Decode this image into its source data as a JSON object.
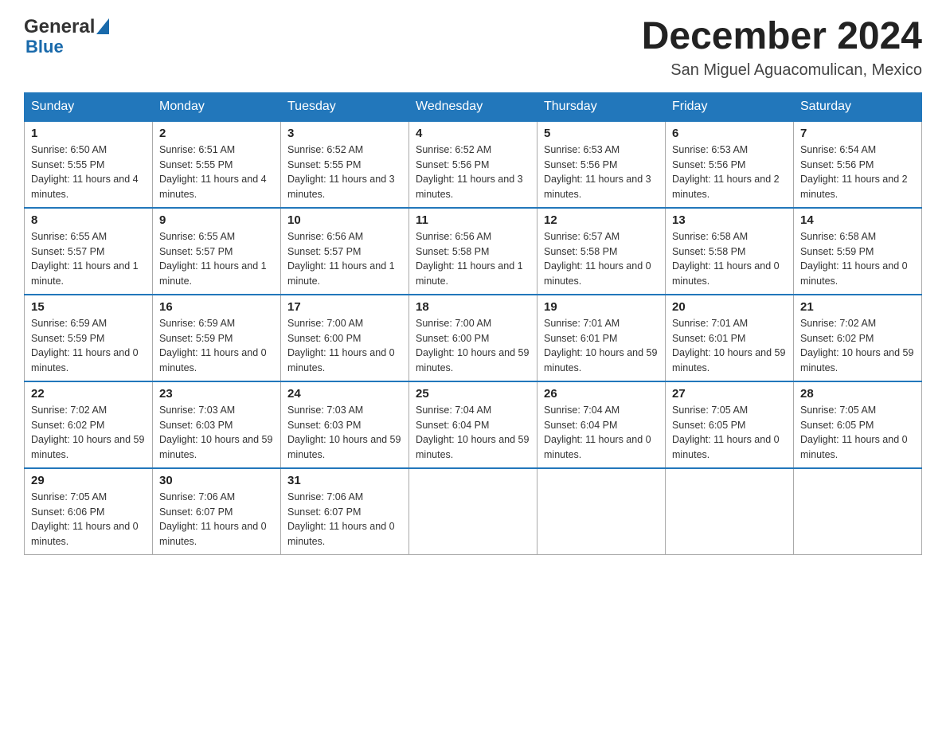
{
  "header": {
    "logo_general": "General",
    "logo_blue": "Blue",
    "month_title": "December 2024",
    "location": "San Miguel Aguacomulican, Mexico"
  },
  "days_of_week": [
    "Sunday",
    "Monday",
    "Tuesday",
    "Wednesday",
    "Thursday",
    "Friday",
    "Saturday"
  ],
  "weeks": [
    [
      {
        "day": "1",
        "sunrise": "6:50 AM",
        "sunset": "5:55 PM",
        "daylight": "11 hours and 4 minutes."
      },
      {
        "day": "2",
        "sunrise": "6:51 AM",
        "sunset": "5:55 PM",
        "daylight": "11 hours and 4 minutes."
      },
      {
        "day": "3",
        "sunrise": "6:52 AM",
        "sunset": "5:55 PM",
        "daylight": "11 hours and 3 minutes."
      },
      {
        "day": "4",
        "sunrise": "6:52 AM",
        "sunset": "5:56 PM",
        "daylight": "11 hours and 3 minutes."
      },
      {
        "day": "5",
        "sunrise": "6:53 AM",
        "sunset": "5:56 PM",
        "daylight": "11 hours and 3 minutes."
      },
      {
        "day": "6",
        "sunrise": "6:53 AM",
        "sunset": "5:56 PM",
        "daylight": "11 hours and 2 minutes."
      },
      {
        "day": "7",
        "sunrise": "6:54 AM",
        "sunset": "5:56 PM",
        "daylight": "11 hours and 2 minutes."
      }
    ],
    [
      {
        "day": "8",
        "sunrise": "6:55 AM",
        "sunset": "5:57 PM",
        "daylight": "11 hours and 1 minute."
      },
      {
        "day": "9",
        "sunrise": "6:55 AM",
        "sunset": "5:57 PM",
        "daylight": "11 hours and 1 minute."
      },
      {
        "day": "10",
        "sunrise": "6:56 AM",
        "sunset": "5:57 PM",
        "daylight": "11 hours and 1 minute."
      },
      {
        "day": "11",
        "sunrise": "6:56 AM",
        "sunset": "5:58 PM",
        "daylight": "11 hours and 1 minute."
      },
      {
        "day": "12",
        "sunrise": "6:57 AM",
        "sunset": "5:58 PM",
        "daylight": "11 hours and 0 minutes."
      },
      {
        "day": "13",
        "sunrise": "6:58 AM",
        "sunset": "5:58 PM",
        "daylight": "11 hours and 0 minutes."
      },
      {
        "day": "14",
        "sunrise": "6:58 AM",
        "sunset": "5:59 PM",
        "daylight": "11 hours and 0 minutes."
      }
    ],
    [
      {
        "day": "15",
        "sunrise": "6:59 AM",
        "sunset": "5:59 PM",
        "daylight": "11 hours and 0 minutes."
      },
      {
        "day": "16",
        "sunrise": "6:59 AM",
        "sunset": "5:59 PM",
        "daylight": "11 hours and 0 minutes."
      },
      {
        "day": "17",
        "sunrise": "7:00 AM",
        "sunset": "6:00 PM",
        "daylight": "11 hours and 0 minutes."
      },
      {
        "day": "18",
        "sunrise": "7:00 AM",
        "sunset": "6:00 PM",
        "daylight": "10 hours and 59 minutes."
      },
      {
        "day": "19",
        "sunrise": "7:01 AM",
        "sunset": "6:01 PM",
        "daylight": "10 hours and 59 minutes."
      },
      {
        "day": "20",
        "sunrise": "7:01 AM",
        "sunset": "6:01 PM",
        "daylight": "10 hours and 59 minutes."
      },
      {
        "day": "21",
        "sunrise": "7:02 AM",
        "sunset": "6:02 PM",
        "daylight": "10 hours and 59 minutes."
      }
    ],
    [
      {
        "day": "22",
        "sunrise": "7:02 AM",
        "sunset": "6:02 PM",
        "daylight": "10 hours and 59 minutes."
      },
      {
        "day": "23",
        "sunrise": "7:03 AM",
        "sunset": "6:03 PM",
        "daylight": "10 hours and 59 minutes."
      },
      {
        "day": "24",
        "sunrise": "7:03 AM",
        "sunset": "6:03 PM",
        "daylight": "10 hours and 59 minutes."
      },
      {
        "day": "25",
        "sunrise": "7:04 AM",
        "sunset": "6:04 PM",
        "daylight": "10 hours and 59 minutes."
      },
      {
        "day": "26",
        "sunrise": "7:04 AM",
        "sunset": "6:04 PM",
        "daylight": "11 hours and 0 minutes."
      },
      {
        "day": "27",
        "sunrise": "7:05 AM",
        "sunset": "6:05 PM",
        "daylight": "11 hours and 0 minutes."
      },
      {
        "day": "28",
        "sunrise": "7:05 AM",
        "sunset": "6:05 PM",
        "daylight": "11 hours and 0 minutes."
      }
    ],
    [
      {
        "day": "29",
        "sunrise": "7:05 AM",
        "sunset": "6:06 PM",
        "daylight": "11 hours and 0 minutes."
      },
      {
        "day": "30",
        "sunrise": "7:06 AM",
        "sunset": "6:07 PM",
        "daylight": "11 hours and 0 minutes."
      },
      {
        "day": "31",
        "sunrise": "7:06 AM",
        "sunset": "6:07 PM",
        "daylight": "11 hours and 0 minutes."
      },
      null,
      null,
      null,
      null
    ]
  ],
  "labels": {
    "sunrise_prefix": "Sunrise: ",
    "sunset_prefix": "Sunset: ",
    "daylight_prefix": "Daylight: "
  }
}
